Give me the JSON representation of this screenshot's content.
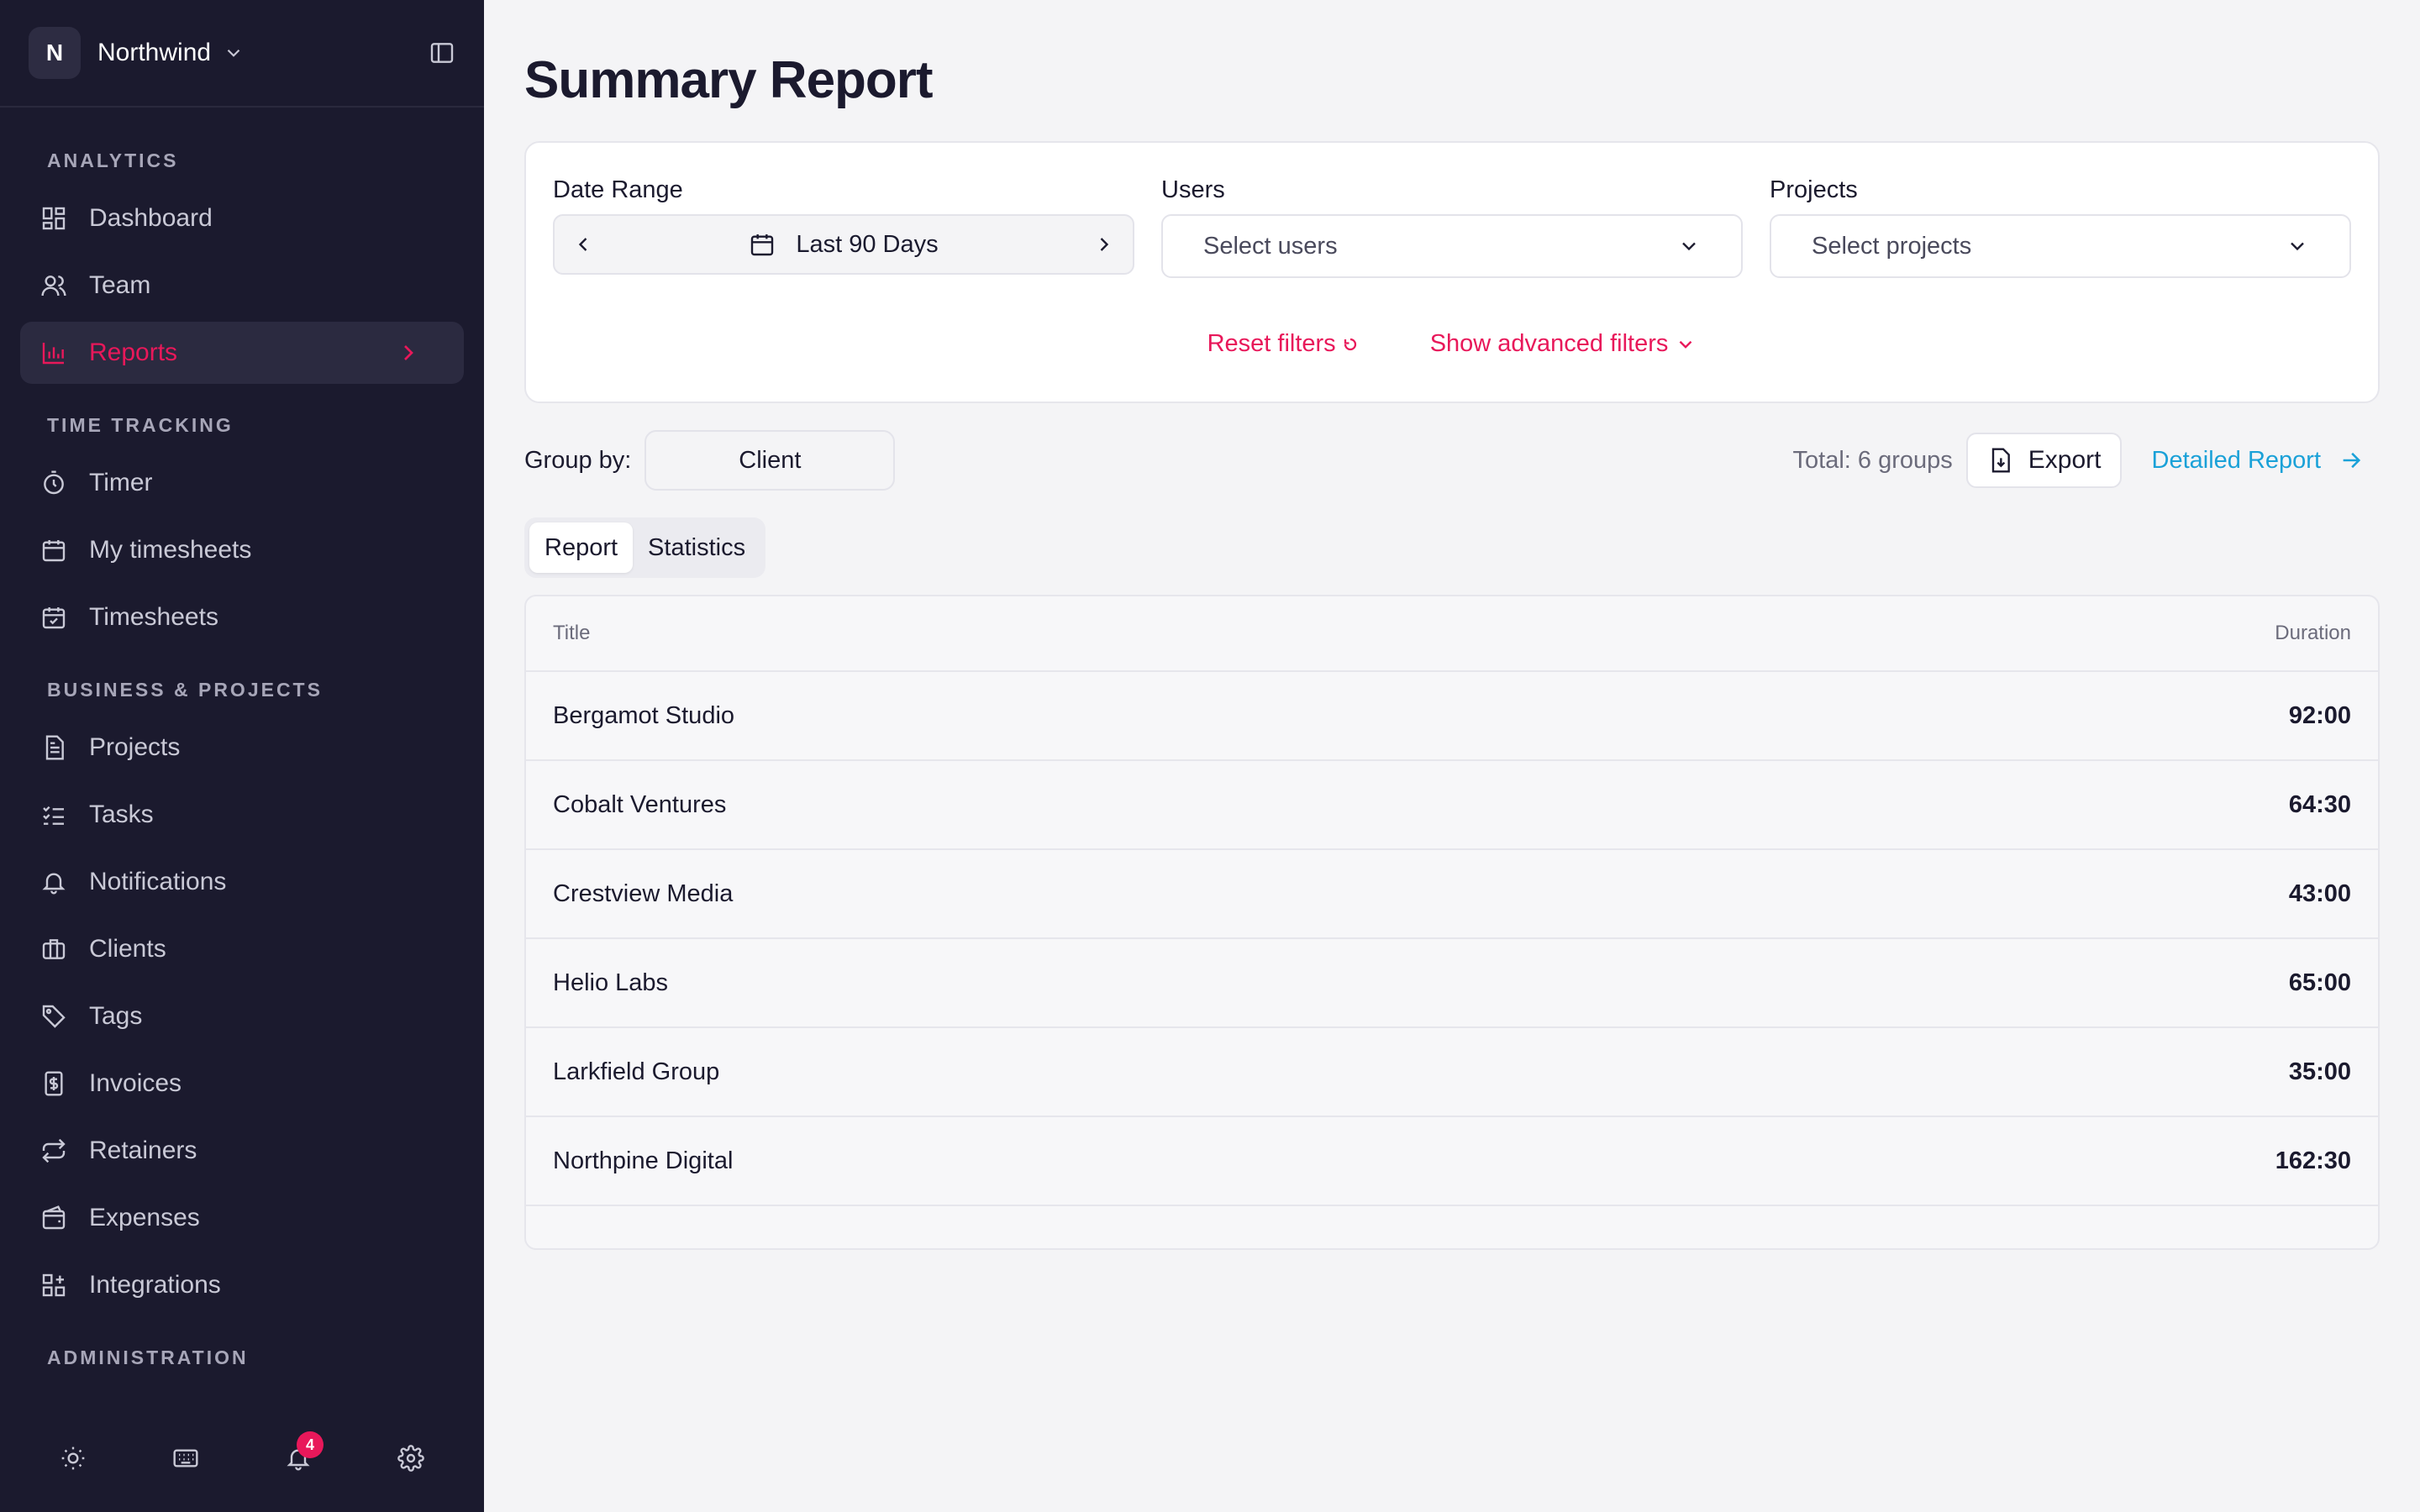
{
  "workspace": {
    "initial": "N",
    "name": "Northwind"
  },
  "sidebar": {
    "sections": [
      {
        "title": "ANALYTICS",
        "items": [
          {
            "label": "Dashboard",
            "icon": "dashboard-icon"
          },
          {
            "label": "Team",
            "icon": "team-icon"
          },
          {
            "label": "Reports",
            "icon": "reports-icon",
            "active": true
          }
        ]
      },
      {
        "title": "TIME TRACKING",
        "items": [
          {
            "label": "Timer",
            "icon": "timer-icon"
          },
          {
            "label": "My timesheets",
            "icon": "calendar-icon"
          },
          {
            "label": "Timesheets",
            "icon": "calendar-check-icon"
          }
        ]
      },
      {
        "title": "BUSINESS & PROJECTS",
        "items": [
          {
            "label": "Projects",
            "icon": "document-icon"
          },
          {
            "label": "Tasks",
            "icon": "tasks-icon"
          },
          {
            "label": "Notifications",
            "icon": "bell-icon"
          },
          {
            "label": "Clients",
            "icon": "briefcase-icon"
          },
          {
            "label": "Tags",
            "icon": "tag-icon"
          },
          {
            "label": "Invoices",
            "icon": "invoice-icon"
          },
          {
            "label": "Retainers",
            "icon": "repeat-icon"
          },
          {
            "label": "Expenses",
            "icon": "wallet-icon"
          },
          {
            "label": "Integrations",
            "icon": "integrations-icon"
          }
        ]
      },
      {
        "title": "ADMINISTRATION",
        "items": []
      }
    ],
    "notifications_count": "4"
  },
  "page": {
    "title": "Summary Report"
  },
  "filters": {
    "date_label": "Date Range",
    "date_value": "Last 90 Days",
    "users_label": "Users",
    "users_placeholder": "Select users",
    "projects_label": "Projects",
    "projects_placeholder": "Select projects",
    "reset": "Reset filters",
    "advanced": "Show advanced filters"
  },
  "toolbar": {
    "group_label": "Group by:",
    "group_value": "Client",
    "total": "Total: 6 groups",
    "export": "Export",
    "detailed": "Detailed Report"
  },
  "tabs": [
    "Report",
    "Statistics"
  ],
  "table": {
    "col_title": "Title",
    "col_duration": "Duration",
    "rows": [
      {
        "title": "Bergamot Studio",
        "duration": "92:00"
      },
      {
        "title": "Cobalt Ventures",
        "duration": "64:30"
      },
      {
        "title": "Crestview Media",
        "duration": "43:00"
      },
      {
        "title": "Helio Labs",
        "duration": "65:00"
      },
      {
        "title": "Larkfield Group",
        "duration": "35:00"
      },
      {
        "title": "Northpine Digital",
        "duration": "162:30"
      }
    ]
  },
  "colors": {
    "accent": "#e8185a",
    "link": "#1aa1d8",
    "sidebar_bg": "#1b1a2e"
  }
}
